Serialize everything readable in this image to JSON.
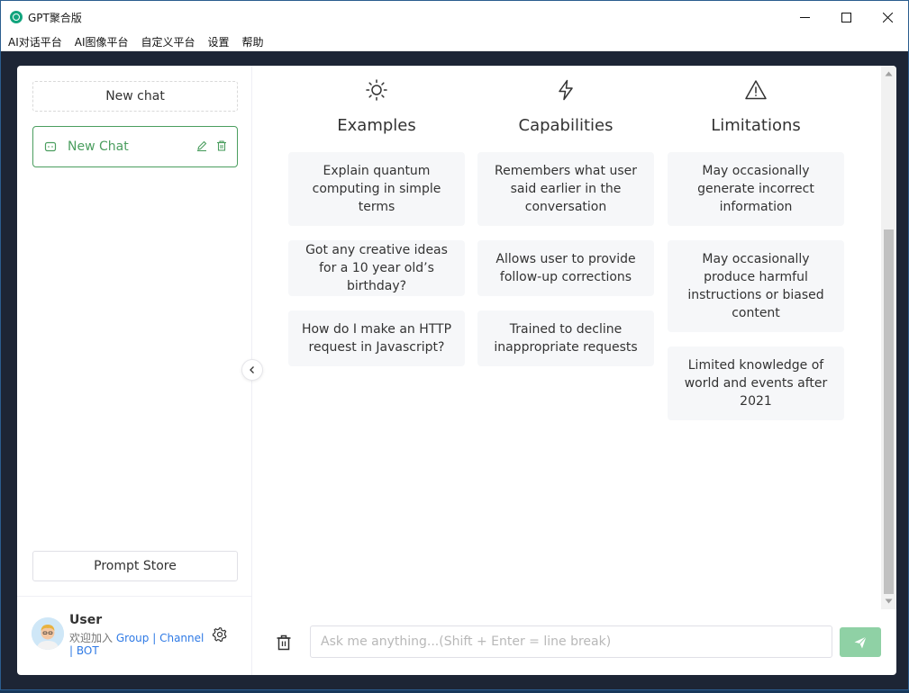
{
  "window": {
    "title": "GPT聚合版",
    "controls": {
      "minimize": "—",
      "maximize": "☐",
      "close": "✕"
    }
  },
  "menu": {
    "items": [
      "AI对话平台",
      "AI图像平台",
      "自定义平台",
      "设置",
      "帮助"
    ]
  },
  "sidebar": {
    "new_chat_label": "New chat",
    "chats": [
      {
        "label": "New Chat",
        "active": true
      }
    ],
    "prompt_store_label": "Prompt Store",
    "user": {
      "name": "User",
      "welcome_text": "欢迎加入",
      "links": {
        "group": "Group",
        "channel": "Channel",
        "bot": "BOT"
      },
      "separator": "|"
    }
  },
  "main": {
    "columns": [
      {
        "icon": "sun-icon",
        "title": "Examples",
        "cards": [
          "Explain quantum computing in simple terms",
          "Got any creative ideas for a 10 year old’s birthday?",
          "How do I make an HTTP request in Javascript?"
        ]
      },
      {
        "icon": "lightning-icon",
        "title": "Capabilities",
        "cards": [
          "Remembers what user said earlier in the conversation",
          "Allows user to provide follow-up corrections",
          "Trained to decline inappropriate requests"
        ]
      },
      {
        "icon": "warning-icon",
        "title": "Limitations",
        "cards": [
          "May occasionally generate incorrect information",
          "May occasionally produce harmful instructions or biased content",
          "Limited knowledge of world and events after 2021"
        ]
      }
    ],
    "input_placeholder": "Ask me anything...(Shift + Enter = line break)"
  },
  "colors": {
    "accent_green": "#4b9e5f",
    "send_button": "#8fd1a5",
    "link_blue": "#2f7ae5",
    "card_bg": "#f6f7f9",
    "frame_bg": "#1d2535"
  }
}
